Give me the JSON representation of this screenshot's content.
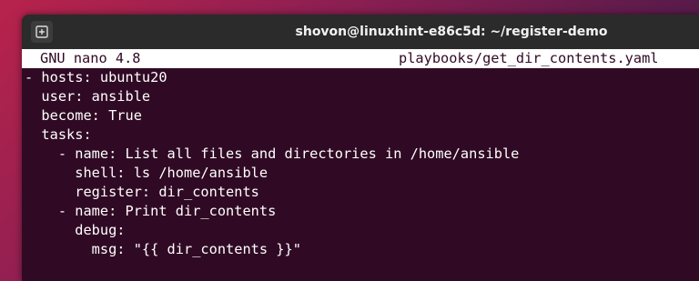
{
  "window": {
    "title": "shovon@linuxhint-e86c5d: ~/register-demo",
    "new_tab_icon": "new-tab-icon"
  },
  "nano": {
    "version": "GNU nano 4.8",
    "filename": "playbooks/get_dir_contents.yaml"
  },
  "code_lines": [
    "- hosts: ubuntu20",
    "  user: ansible",
    "  become: True",
    "  tasks:",
    "    - name: List all files and directories in /home/ansible",
    "      shell: ls /home/ansible",
    "      register: dir_contents",
    "    - name: Print dir_contents",
    "      debug:",
    "        msg: \"{{ dir_contents }}\""
  ],
  "colors": {
    "terminal_bg": "#300a24",
    "titlebar_bg": "#2b2b2b",
    "text": "#ffffff"
  }
}
